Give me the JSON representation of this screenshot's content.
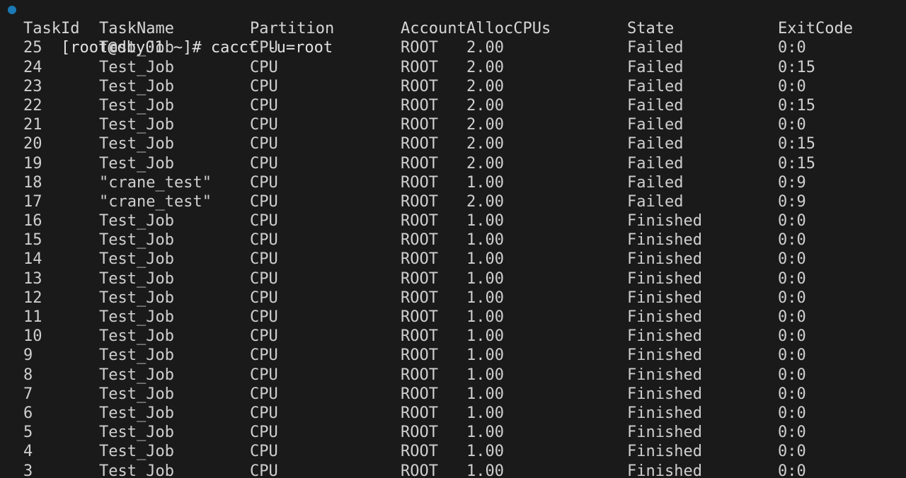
{
  "terminal": {
    "status_dot_color": "#1a7ab5",
    "background_color": "#1a1a1a",
    "foreground_color": "#cfcfcf",
    "prompt": "[root@dby01 ~]# cacct -u=root",
    "user": "root",
    "host": "dby01",
    "cwd": "~",
    "command": "cacct -u=root"
  },
  "table": {
    "headers": {
      "taskid": "TaskId",
      "taskname": "TaskName",
      "partition": "Partition",
      "account": "Account",
      "alloccpus": "AllocCPUs",
      "state": "State",
      "exitcode": "ExitCode"
    },
    "rows": [
      {
        "taskid": "25",
        "taskname": "Test_Job",
        "partition": "CPU",
        "account": "ROOT",
        "alloccpus": "2.00",
        "state": "Failed",
        "exitcode": "0:0"
      },
      {
        "taskid": "24",
        "taskname": "Test_Job",
        "partition": "CPU",
        "account": "ROOT",
        "alloccpus": "2.00",
        "state": "Failed",
        "exitcode": "0:15"
      },
      {
        "taskid": "23",
        "taskname": "Test_Job",
        "partition": "CPU",
        "account": "ROOT",
        "alloccpus": "2.00",
        "state": "Failed",
        "exitcode": "0:0"
      },
      {
        "taskid": "22",
        "taskname": "Test_Job",
        "partition": "CPU",
        "account": "ROOT",
        "alloccpus": "2.00",
        "state": "Failed",
        "exitcode": "0:15"
      },
      {
        "taskid": "21",
        "taskname": "Test_Job",
        "partition": "CPU",
        "account": "ROOT",
        "alloccpus": "2.00",
        "state": "Failed",
        "exitcode": "0:0"
      },
      {
        "taskid": "20",
        "taskname": "Test_Job",
        "partition": "CPU",
        "account": "ROOT",
        "alloccpus": "2.00",
        "state": "Failed",
        "exitcode": "0:15"
      },
      {
        "taskid": "19",
        "taskname": "Test_Job",
        "partition": "CPU",
        "account": "ROOT",
        "alloccpus": "2.00",
        "state": "Failed",
        "exitcode": "0:15"
      },
      {
        "taskid": "18",
        "taskname": "\"crane_test\"",
        "partition": "CPU",
        "account": "ROOT",
        "alloccpus": "1.00",
        "state": "Failed",
        "exitcode": "0:9"
      },
      {
        "taskid": "17",
        "taskname": "\"crane_test\"",
        "partition": "CPU",
        "account": "ROOT",
        "alloccpus": "2.00",
        "state": "Failed",
        "exitcode": "0:9"
      },
      {
        "taskid": "16",
        "taskname": "Test_Job",
        "partition": "CPU",
        "account": "ROOT",
        "alloccpus": "1.00",
        "state": "Finished",
        "exitcode": "0:0"
      },
      {
        "taskid": "15",
        "taskname": "Test_Job",
        "partition": "CPU",
        "account": "ROOT",
        "alloccpus": "1.00",
        "state": "Finished",
        "exitcode": "0:0"
      },
      {
        "taskid": "14",
        "taskname": "Test_Job",
        "partition": "CPU",
        "account": "ROOT",
        "alloccpus": "1.00",
        "state": "Finished",
        "exitcode": "0:0"
      },
      {
        "taskid": "13",
        "taskname": "Test_Job",
        "partition": "CPU",
        "account": "ROOT",
        "alloccpus": "1.00",
        "state": "Finished",
        "exitcode": "0:0"
      },
      {
        "taskid": "12",
        "taskname": "Test_Job",
        "partition": "CPU",
        "account": "ROOT",
        "alloccpus": "1.00",
        "state": "Finished",
        "exitcode": "0:0"
      },
      {
        "taskid": "11",
        "taskname": "Test_Job",
        "partition": "CPU",
        "account": "ROOT",
        "alloccpus": "1.00",
        "state": "Finished",
        "exitcode": "0:0"
      },
      {
        "taskid": "10",
        "taskname": "Test_Job",
        "partition": "CPU",
        "account": "ROOT",
        "alloccpus": "1.00",
        "state": "Finished",
        "exitcode": "0:0"
      },
      {
        "taskid": "9",
        "taskname": "Test_Job",
        "partition": "CPU",
        "account": "ROOT",
        "alloccpus": "1.00",
        "state": "Finished",
        "exitcode": "0:0"
      },
      {
        "taskid": "8",
        "taskname": "Test_Job",
        "partition": "CPU",
        "account": "ROOT",
        "alloccpus": "1.00",
        "state": "Finished",
        "exitcode": "0:0"
      },
      {
        "taskid": "7",
        "taskname": "Test_Job",
        "partition": "CPU",
        "account": "ROOT",
        "alloccpus": "1.00",
        "state": "Finished",
        "exitcode": "0:0"
      },
      {
        "taskid": "6",
        "taskname": "Test_Job",
        "partition": "CPU",
        "account": "ROOT",
        "alloccpus": "1.00",
        "state": "Finished",
        "exitcode": "0:0"
      },
      {
        "taskid": "5",
        "taskname": "Test_Job",
        "partition": "CPU",
        "account": "ROOT",
        "alloccpus": "1.00",
        "state": "Finished",
        "exitcode": "0:0"
      },
      {
        "taskid": "4",
        "taskname": "Test_Job",
        "partition": "CPU",
        "account": "ROOT",
        "alloccpus": "1.00",
        "state": "Finished",
        "exitcode": "0:0"
      },
      {
        "taskid": "3",
        "taskname": "Test_Job",
        "partition": "CPU",
        "account": "ROOT",
        "alloccpus": "1.00",
        "state": "Finished",
        "exitcode": "0:0"
      }
    ]
  }
}
